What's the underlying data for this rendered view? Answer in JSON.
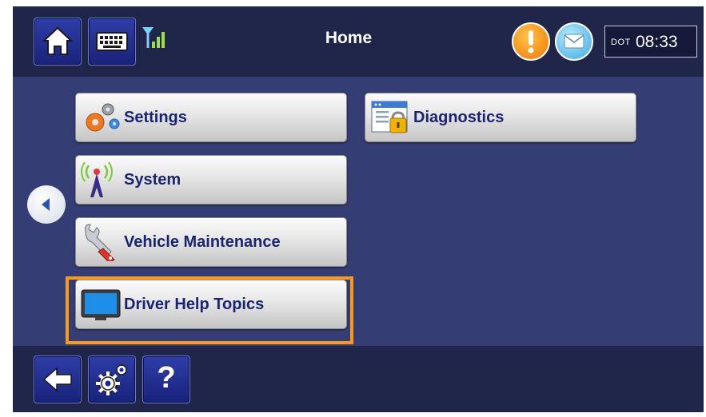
{
  "header": {
    "title": "Home",
    "clock_label": "DOT",
    "clock_time": "08:33"
  },
  "menu": {
    "left": [
      {
        "label": "Settings",
        "icon": "gears-icon"
      },
      {
        "label": "System",
        "icon": "antenna-icon"
      },
      {
        "label": "Vehicle Maintenance",
        "icon": "wrench-icon"
      },
      {
        "label": "Driver Help Topics",
        "icon": "monitor-icon"
      }
    ],
    "right": [
      {
        "label": "Diagnostics",
        "icon": "locked-window-icon"
      }
    ]
  },
  "footer": {
    "help_label": "?"
  },
  "colors": {
    "screen_bg": "#343d74",
    "bar_bg": "#20254a",
    "highlight": "#f79a1e",
    "label": "#1b2470"
  }
}
